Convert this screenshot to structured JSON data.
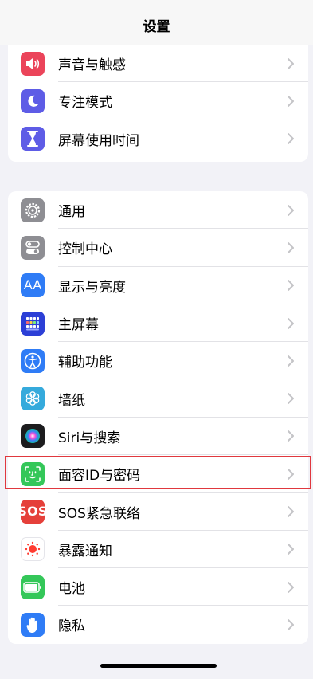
{
  "nav": {
    "title": "设置"
  },
  "group_top": {
    "items": [
      {
        "label": "声音与触感",
        "icon": "speaker-icon",
        "color": "#eb445a"
      },
      {
        "label": "专注模式",
        "icon": "moon-icon",
        "color": "#5e5ce6"
      },
      {
        "label": "屏幕使用时间",
        "icon": "hourglass-icon",
        "color": "#5e5ce6"
      }
    ]
  },
  "group_main": {
    "items": [
      {
        "label": "通用",
        "icon": "gear-icon",
        "color": "#8e8e93"
      },
      {
        "label": "控制中心",
        "icon": "toggles-icon",
        "color": "#8e8e93"
      },
      {
        "label": "显示与亮度",
        "icon": "text-size-icon",
        "icon_text": "AA",
        "color": "#2f7cf6"
      },
      {
        "label": "主屏幕",
        "icon": "home-grid-icon",
        "color": "#2c3fd6"
      },
      {
        "label": "辅助功能",
        "icon": "accessibility-icon",
        "color": "#2f7cf6"
      },
      {
        "label": "墙纸",
        "icon": "flower-icon",
        "color": "#35aadc"
      },
      {
        "label": "Siri与搜索",
        "icon": "siri-icon",
        "color": "#1c1c1e"
      },
      {
        "label": "面容ID与密码",
        "icon": "face-id-icon",
        "color": "#34c759"
      },
      {
        "label": "SOS紧急联络",
        "icon": "sos-icon",
        "icon_text": "SOS",
        "color": "#e5403a"
      },
      {
        "label": "暴露通知",
        "icon": "exposure-icon",
        "color": "#ffffff"
      },
      {
        "label": "电池",
        "icon": "battery-icon",
        "color": "#34c759"
      },
      {
        "label": "隐私",
        "icon": "hand-icon",
        "color": "#2f7cf6"
      }
    ]
  },
  "highlight_color": "#e0383e"
}
